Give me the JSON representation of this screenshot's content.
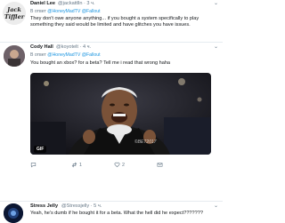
{
  "tweets": [
    {
      "avatar_text": "Jack Tiffler",
      "name": "Daniel Lee",
      "handle": "@jackattlln",
      "time": "· 3 ч.",
      "reply_prefix": "В ответ",
      "reply_to": "@HoneyMadTV @Fallout",
      "text": "They don't owe anyone anything... if you bought a system specifically to play something they said would be limited and have glitches you have issues."
    },
    {
      "name": "Cody Hall",
      "handle": "@koyotelt",
      "time": "· 4 ч.",
      "reply_prefix": "В ответ",
      "reply_to": "@HoneyMadTV @Fallout",
      "text": "You bought an xbox? for a beta? Tell me i read that wrong haha",
      "media": {
        "badge": "GIF",
        "watermark": "©BET2017"
      },
      "actions": {
        "reply_count": "",
        "retweet_count": "1",
        "like_count": "2"
      }
    },
    {
      "name": "Stress Jelly",
      "handle": "@Stressjelly",
      "time": "· 5 ч.",
      "text": "Yeah, he's dumb if he bought it for a beta. What the hell did he expect???????"
    }
  ],
  "colors": {
    "link": "#1b95e0",
    "muted": "#657786",
    "divider": "#e6ecf0"
  }
}
